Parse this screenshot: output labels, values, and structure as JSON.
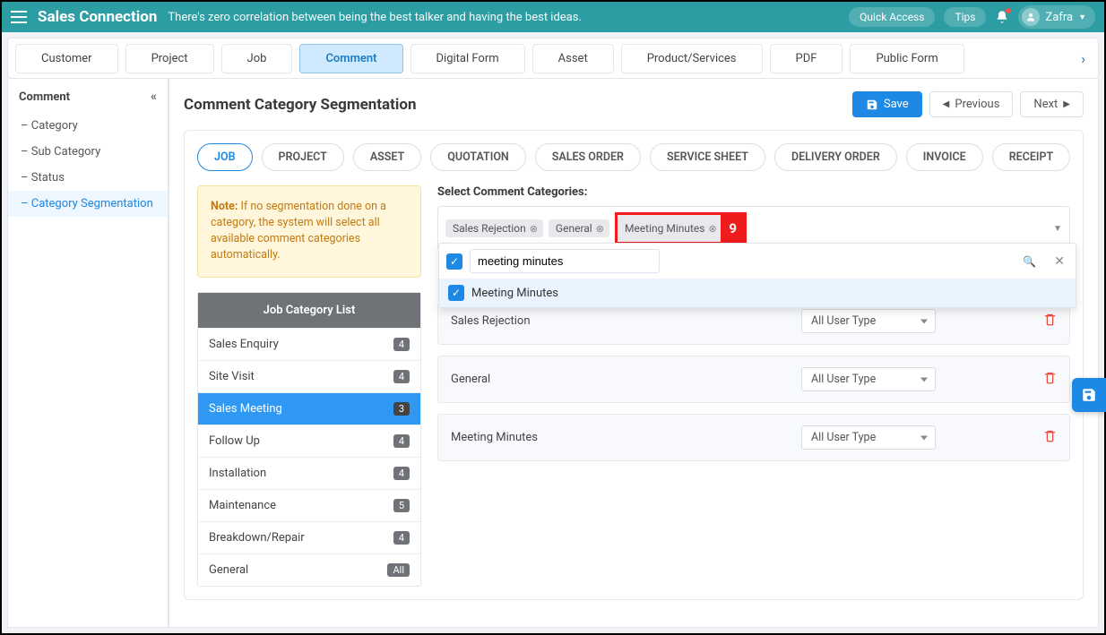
{
  "header": {
    "brand": "Sales Connection",
    "tagline": "There's zero correlation between being the best talker and having the best ideas.",
    "quick_access": "Quick Access",
    "tips": "Tips",
    "username": "Zafra"
  },
  "main_tabs": {
    "items": [
      "Customer",
      "Project",
      "Job",
      "Comment",
      "Digital Form",
      "Asset",
      "Product/Services",
      "PDF",
      "Public Form"
    ],
    "active_index": 3
  },
  "sidebar": {
    "title": "Comment",
    "items": [
      {
        "label": "– Category"
      },
      {
        "label": "– Sub Category"
      },
      {
        "label": "  – Status"
      },
      {
        "label": "  – Category Segmentation"
      }
    ],
    "active_index": 3
  },
  "page": {
    "title": "Comment Category Segmentation",
    "save": "Save",
    "prev": "Previous",
    "next": "Next"
  },
  "type_pills": {
    "items": [
      "JOB",
      "PROJECT",
      "ASSET",
      "QUOTATION",
      "SALES ORDER",
      "SERVICE SHEET",
      "DELIVERY ORDER",
      "INVOICE",
      "RECEIPT"
    ],
    "active_index": 0
  },
  "note": {
    "label": "Note:",
    "text": "If no segmentation done on a category, the system will select all available comment categories automatically."
  },
  "category_list": {
    "title": "Job Category List",
    "items": [
      {
        "label": "Sales Enquiry",
        "badge": "4"
      },
      {
        "label": "Site Visit",
        "badge": "4"
      },
      {
        "label": "Sales Meeting",
        "badge": "3"
      },
      {
        "label": "Follow Up",
        "badge": "4"
      },
      {
        "label": "Installation",
        "badge": "4"
      },
      {
        "label": "Maintenance",
        "badge": "5"
      },
      {
        "label": "Breakdown/Repair",
        "badge": "4"
      },
      {
        "label": "General",
        "badge": "All"
      }
    ],
    "selected_index": 2
  },
  "selector": {
    "label": "Select Comment Categories:",
    "tags": [
      "Sales Rejection",
      "General",
      "Meeting Minutes"
    ],
    "highlight_index": 2,
    "callout_number": "9",
    "search_value": "meeting minutes",
    "dropdown_option": "Meeting Minutes"
  },
  "assignments": {
    "user_type_default": "All User Type",
    "rows": [
      {
        "label": "Sales Rejection"
      },
      {
        "label": "General"
      },
      {
        "label": "Meeting Minutes"
      }
    ]
  }
}
